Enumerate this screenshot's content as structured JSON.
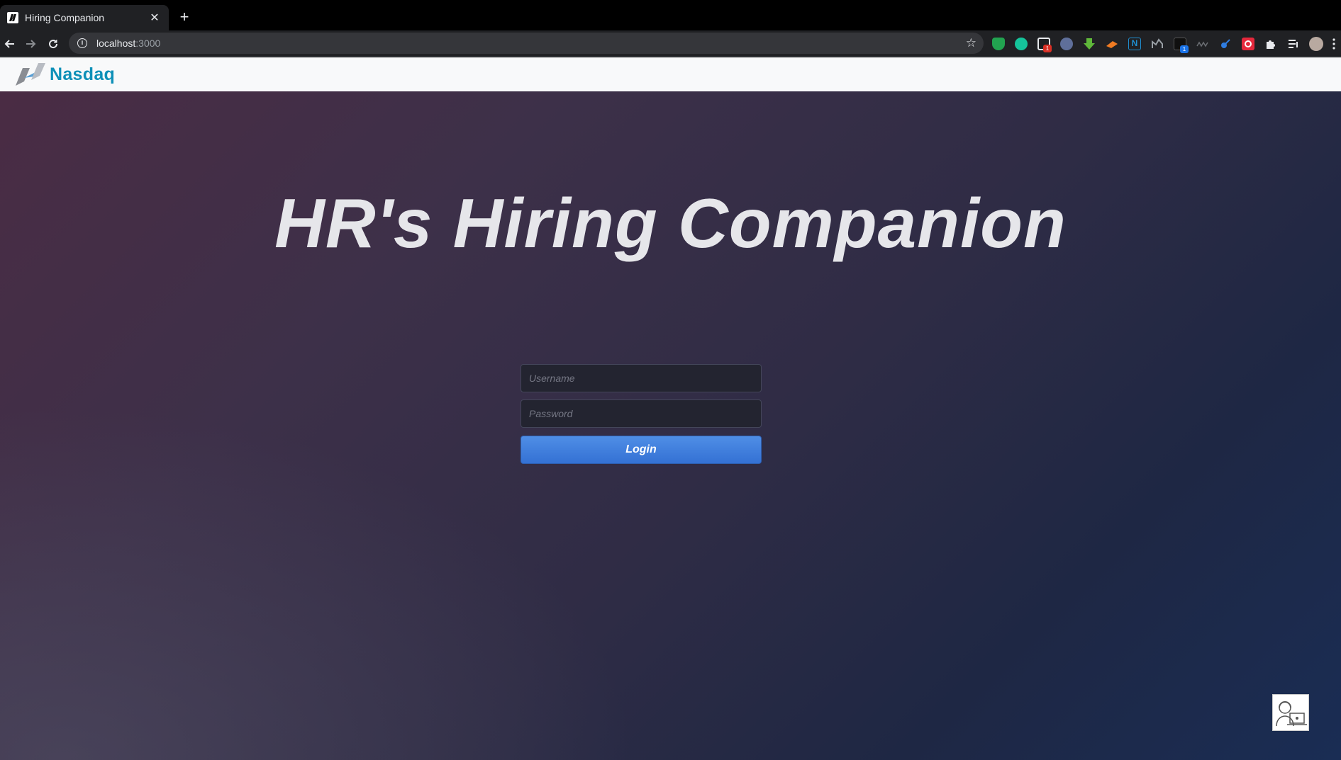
{
  "browser": {
    "tab_title": "Hiring Companion",
    "tab_close": "✕",
    "new_tab": "+",
    "url_host": "localhost",
    "url_port": ":3000",
    "star": "☆",
    "extension_badges": [
      "1",
      "1"
    ]
  },
  "navbar": {
    "logo_text": "Nasdaq"
  },
  "hero": {
    "title": "HR's Hiring Companion"
  },
  "login_form": {
    "username_placeholder": "Username",
    "password_placeholder": "Password",
    "login_label": "Login"
  },
  "colors": {
    "brand": "#0e90b8",
    "login_button": "#3b7ddd",
    "hero_start": "#4a2c44",
    "hero_end": "#1a2d54"
  }
}
